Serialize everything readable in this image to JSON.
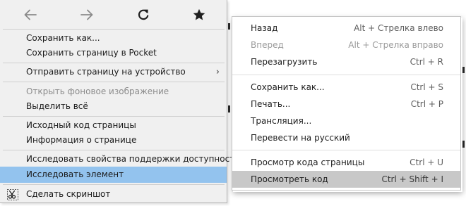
{
  "firefox_menu": {
    "nav_icons": [
      "back-arrow-icon",
      "forward-arrow-icon",
      "reload-icon",
      "bookmark-star-icon"
    ],
    "items": [
      {
        "label": "Сохранить как...",
        "disabled": false
      },
      {
        "label": "Сохранить страницу в Pocket",
        "disabled": false
      },
      {
        "label": "Отправить страницу на устройство",
        "disabled": false,
        "submenu": true
      },
      {
        "label": "Открыть фоновое изображение",
        "disabled": true
      },
      {
        "label": "Выделить всё",
        "disabled": false
      },
      {
        "label": "Исходный код страницы",
        "disabled": false
      },
      {
        "label": "Информация о странице",
        "disabled": false
      },
      {
        "label": "Исследовать свойства поддержки доступности",
        "disabled": false
      },
      {
        "label": "Исследовать элемент",
        "disabled": false,
        "highlighted": true
      },
      {
        "label": "Сделать скриншот",
        "disabled": false,
        "icon": "screenshot-scissors-icon"
      }
    ],
    "submenu_arrow": "›",
    "colors": {
      "background": "#f0f0f0",
      "highlight": "#93c3ee",
      "disabled_text": "#8c8c8c"
    }
  },
  "chrome_menu": {
    "items": [
      {
        "label": "Назад",
        "shortcut": "Alt + Стрелка влево",
        "disabled": false
      },
      {
        "label": "Вперед",
        "shortcut": "Alt + Стрелка вправо",
        "disabled": true
      },
      {
        "label": "Перезагрузить",
        "shortcut": "Ctrl + R",
        "disabled": false
      },
      {
        "label": "Сохранить как...",
        "shortcut": "Ctrl + S",
        "disabled": false
      },
      {
        "label": "Печать...",
        "shortcut": "Ctrl + P",
        "disabled": false
      },
      {
        "label": "Трансляция...",
        "shortcut": "",
        "disabled": false
      },
      {
        "label": "Перевести на русский",
        "shortcut": "",
        "disabled": false
      },
      {
        "label": "Просмотр кода страницы",
        "shortcut": "Ctrl + U",
        "disabled": false
      },
      {
        "label": "Просмотреть код",
        "shortcut": "Ctrl + Shift + I",
        "disabled": false,
        "highlighted": true
      }
    ],
    "colors": {
      "background": "#ffffff",
      "highlight": "#c8c8c8",
      "disabled_text": "#9a9a9a"
    }
  }
}
